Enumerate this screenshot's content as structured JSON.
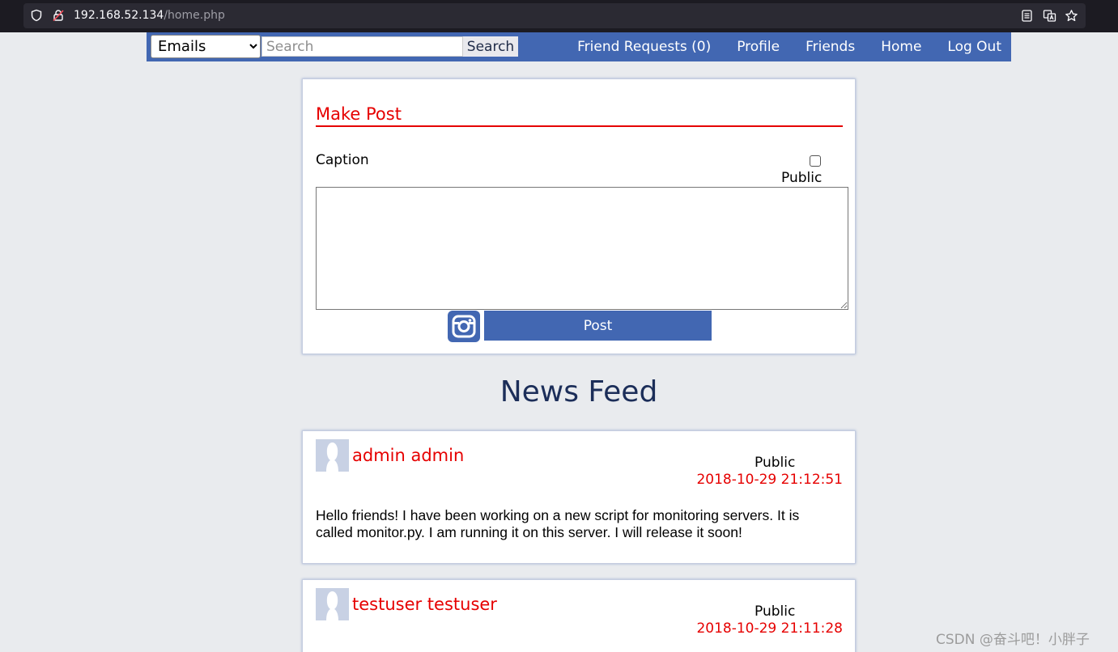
{
  "browser": {
    "url_host": "192.168.52.134",
    "url_path": "/home.php"
  },
  "nav": {
    "search_type_selected": "Emails",
    "search_placeholder": "Search",
    "search_button": "Search",
    "links": [
      "Friend Requests (0)",
      "Profile",
      "Friends",
      "Home",
      "Log Out"
    ]
  },
  "make_post": {
    "title": "Make Post",
    "caption_label": "Caption",
    "public_label": "Public",
    "public_checked": false,
    "post_button": "Post"
  },
  "feed": {
    "title": "News Feed",
    "posts": [
      {
        "author": "admin admin",
        "visibility": "Public",
        "time": "2018-10-29 21:12:51",
        "body": "Hello friends! I have been working on a new script for monitoring servers. It is called monitor.py. I am running it on this server. I will release it soon!"
      },
      {
        "author": "testuser testuser",
        "visibility": "Public",
        "time": "2018-10-29 21:11:28",
        "body": ""
      }
    ]
  },
  "watermark": "CSDN @奋斗吧！小胖子",
  "colors": {
    "brand": "#4267b2",
    "accent": "#e60000",
    "background": "#e9ebee"
  }
}
